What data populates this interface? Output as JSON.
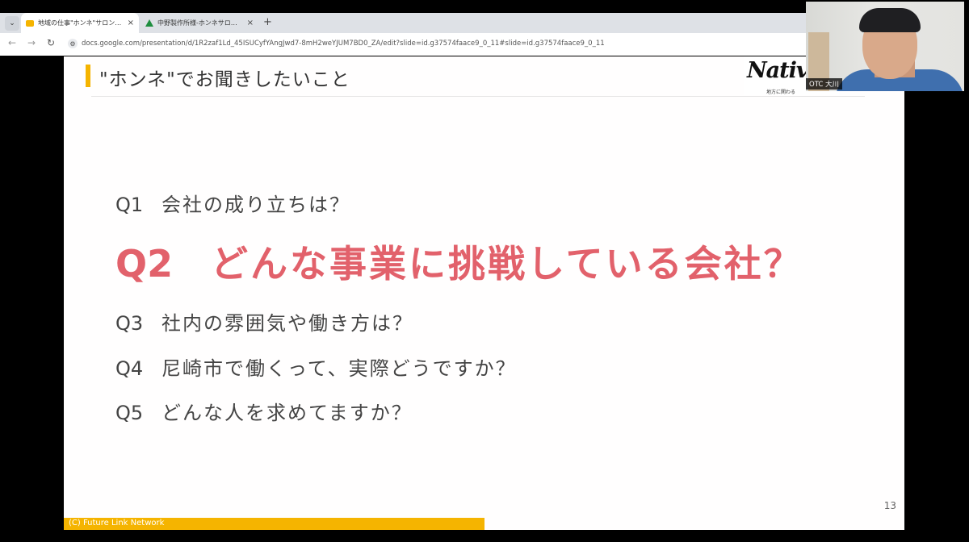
{
  "browser": {
    "tabs": [
      {
        "title": "地域の仕事\"ホンネ\"サロン～尼崎",
        "active": true,
        "favicon": "slides-icon"
      },
      {
        "title": "中野製作所様-ホンネサロン尼崎",
        "active": false,
        "favicon": "drive-icon"
      }
    ],
    "new_tab_label": "+",
    "close_label": "×",
    "dropdown_label": "⌄",
    "url": "docs.google.com/presentation/d/1R2zaf1Ld_45ISUCyfYAngJwd7-8mH2weYJUM7BD0_ZA/edit?slide=id.g37574faace9_0_11#slide=id.g37574faace9_0_11"
  },
  "slide": {
    "title": "\"ホンネ\"でお聞きしたいこと",
    "logo_text": "Nativ",
    "logo_subtext": "地方に関わる",
    "questions": [
      {
        "num": "Q1",
        "text": "会社の成り立ちは？"
      },
      {
        "num": "Q2",
        "text": "どんな事業に挑戦している会社？"
      },
      {
        "num": "Q3",
        "text": "社内の雰囲気や働き方は？"
      },
      {
        "num": "Q4",
        "text": "尼崎市で働くって、実際どうですか？"
      },
      {
        "num": "Q5",
        "text": "どんな人を求めてますか？"
      }
    ],
    "page_number": "13",
    "footer": "(C) Future Link Network"
  },
  "webcam": {
    "label": "OTC 大川"
  },
  "colors": {
    "accent_yellow": "#f5b400",
    "highlight_red": "#e2616b"
  }
}
